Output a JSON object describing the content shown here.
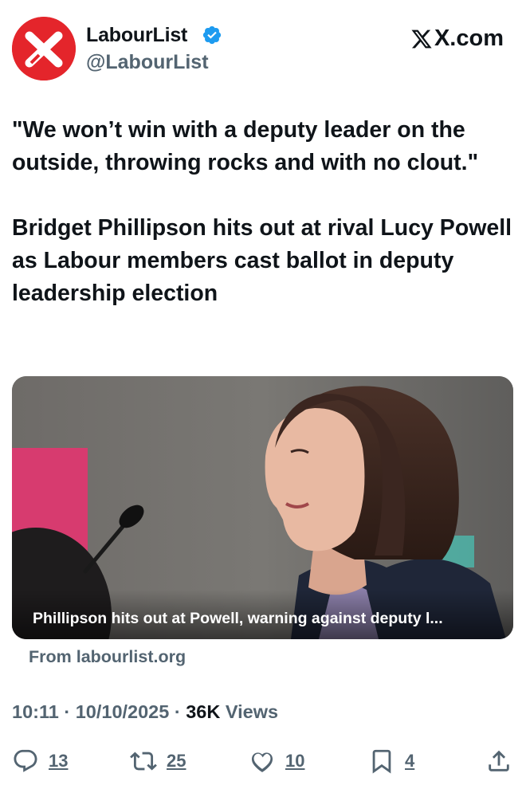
{
  "author": {
    "display_name": "LabourList",
    "handle": "@LabourList",
    "verified": true,
    "avatar_icon": "labourlist-x-logo",
    "brand_color": "#e4252b"
  },
  "source_site": "X.com",
  "tweet": {
    "quote": "\"We won’t win with a deputy leader on the outside, throwing rocks and with no clout.\"",
    "headline": "Bridget Phillipson hits out at rival Lucy Powell as Labour members cast ballot in deputy leadership election"
  },
  "card": {
    "title": "Phillipson hits out at Powell, warning against deputy l...",
    "from": "From labourlist.org"
  },
  "meta": {
    "time": "10:11",
    "date": "10/10/2025",
    "views_count": "36K",
    "views_label": "Views",
    "separator": "·"
  },
  "actions": {
    "replies": "13",
    "reposts": "25",
    "likes": "10",
    "bookmarks": "4"
  }
}
